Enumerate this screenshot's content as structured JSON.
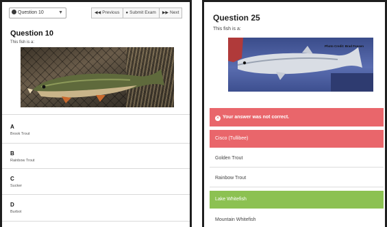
{
  "left": {
    "question_select": "Question 10",
    "buttons": {
      "previous": "Previous",
      "submit": "Submit Exam",
      "next": "Next"
    },
    "title": "Question 10",
    "prompt": "This fish is a:",
    "answers": [
      {
        "letter": "A",
        "text": "Brook Trout"
      },
      {
        "letter": "B",
        "text": "Rainbow Trout"
      },
      {
        "letter": "C",
        "text": "Sucker"
      },
      {
        "letter": "D",
        "text": "Burbot"
      }
    ]
  },
  "right": {
    "title": "Question 25",
    "prompt": "This fish is a:",
    "photo_caption": "Photo Credit: Brad Fossen",
    "feedback": "Your answer was not correct.",
    "options": [
      {
        "text": "Cisco (Tullibee)",
        "state": "wrong"
      },
      {
        "text": "Golden Trout",
        "state": "plain"
      },
      {
        "text": "Rainbow Trout",
        "state": "plain"
      },
      {
        "text": "Lake Whitefish",
        "state": "right"
      },
      {
        "text": "Mountain Whitefish",
        "state": "plain"
      }
    ]
  },
  "colors": {
    "incorrect": "#e9666b",
    "correct": "#8cc152",
    "frame": "#1e1e1e"
  }
}
